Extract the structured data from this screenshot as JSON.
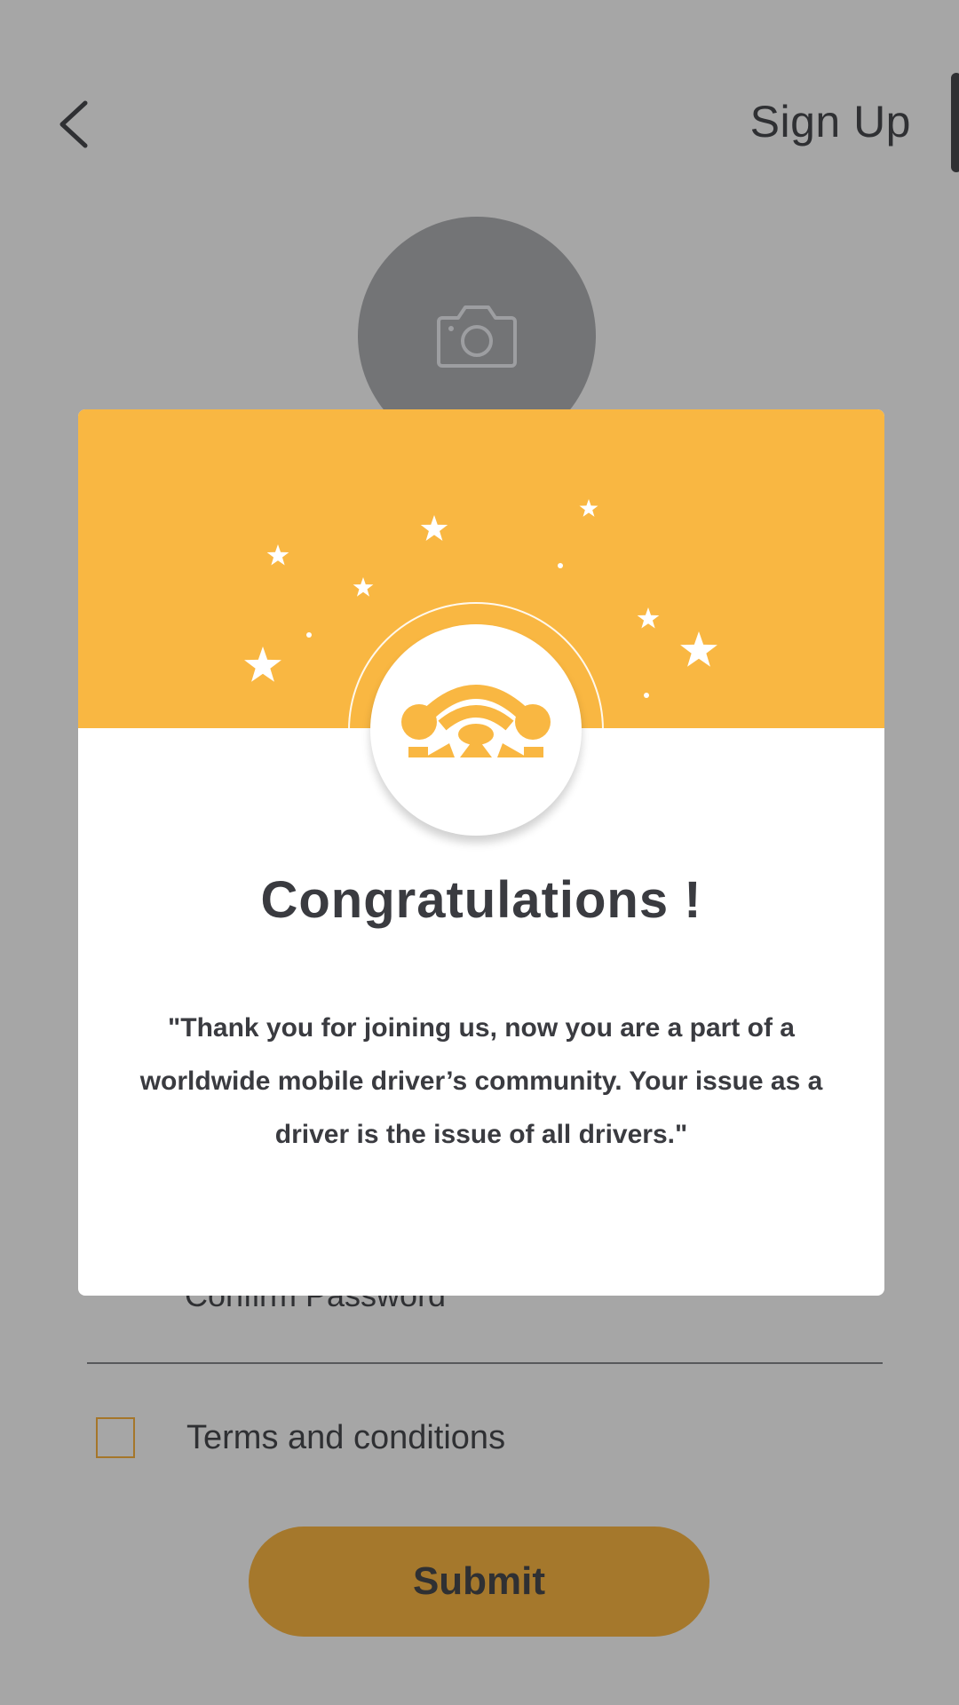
{
  "header": {
    "title": "Sign Up",
    "back_icon": "chevron-left-icon"
  },
  "avatar": {
    "icon": "camera-icon"
  },
  "form": {
    "confirm_password_placeholder": "Confirm Password",
    "terms_label": "Terms and conditions",
    "terms_checked": false,
    "submit_label": "Submit"
  },
  "modal": {
    "title": "Congratulations !",
    "message": "\"Thank you for joining us, now you are a part of a worldwide mobile driver’s community. Your issue as a driver is the issue of all drivers.\"",
    "badge_icon": "steering-wheel-icon",
    "decoration_icon": "star-icon"
  },
  "colors": {
    "accent": "#f9b742",
    "scrim": "#a6a6a6",
    "submit_dimmed": "#a5782c",
    "text_dark": "#3a3b40"
  }
}
